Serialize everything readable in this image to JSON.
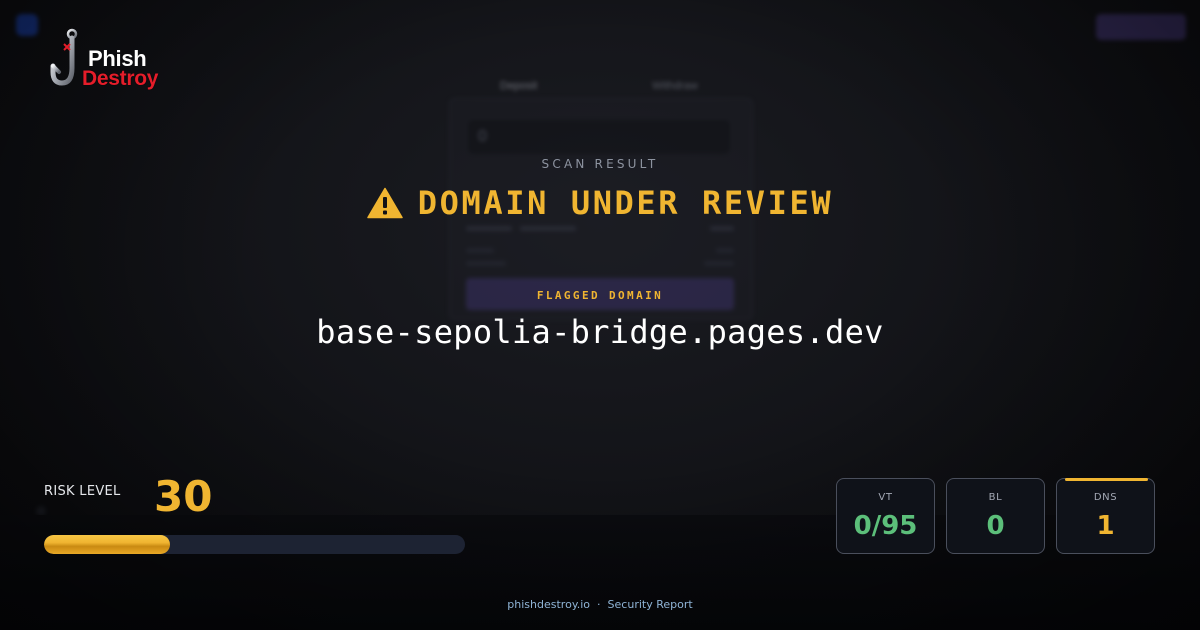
{
  "brand": {
    "name_top": "Phish",
    "name_bottom": "Destroy"
  },
  "background": {
    "tabs": [
      "Deposit",
      "Withdraw"
    ],
    "input_value": "0"
  },
  "scan": {
    "label": "SCAN RESULT",
    "status": "DOMAIN UNDER REVIEW",
    "status_icon": "warning-triangle-icon",
    "flag_label": "FLAGGED DOMAIN",
    "domain": "base-sepolia-bridge.pages.dev"
  },
  "risk": {
    "label": "RISK LEVEL",
    "score": "30",
    "fraction": 0.3
  },
  "stats": [
    {
      "label": "VT",
      "value": "0/95",
      "color": "#5cbf7a",
      "accent": false
    },
    {
      "label": "BL",
      "value": "0",
      "color": "#5cbf7a",
      "accent": false
    },
    {
      "label": "DNS",
      "value": "1",
      "color": "#f0b531",
      "accent": true
    }
  ],
  "footer": {
    "site": "phishdestroy.io",
    "separator": "·",
    "report": "Security Report"
  },
  "colors": {
    "accent": "#f0b531",
    "safe": "#5cbf7a",
    "brand_red": "#e51d2a",
    "background": "#0a0b0f"
  }
}
